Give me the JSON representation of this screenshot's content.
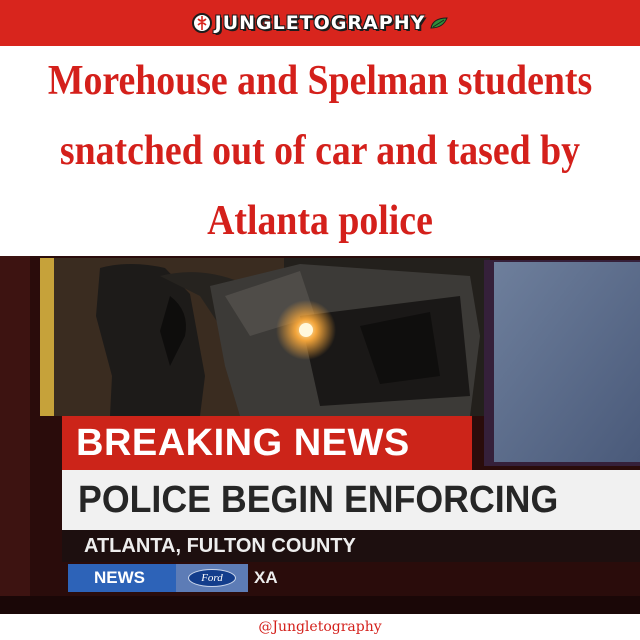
{
  "brand": {
    "name": "JUNGLETOGRAPHY",
    "colors": {
      "bar": "#d8251d",
      "text": "#ffffff"
    }
  },
  "headline": {
    "text": "Morehouse and Spelman students snatched out of car and tased by Atlanta police",
    "color": "#d4201b"
  },
  "broadcast": {
    "breaking_label": "BREAKING NEWS",
    "headline": "POLICE BEGIN ENFORCING",
    "dateline": "ATLANTA, FULTON COUNTY",
    "news_label": "NEWS",
    "sponsor_badge": "Ford",
    "ticker_text": "XA",
    "colors": {
      "breaking_bg": "#cc2419",
      "headline_bg": "#f1f1f1",
      "news_bg": "#2d63b8"
    }
  },
  "footer": {
    "handle": "@Jungletography"
  },
  "icons": [
    "jungle-emblem-icon",
    "leaf-icon",
    "ford-logo-icon"
  ]
}
